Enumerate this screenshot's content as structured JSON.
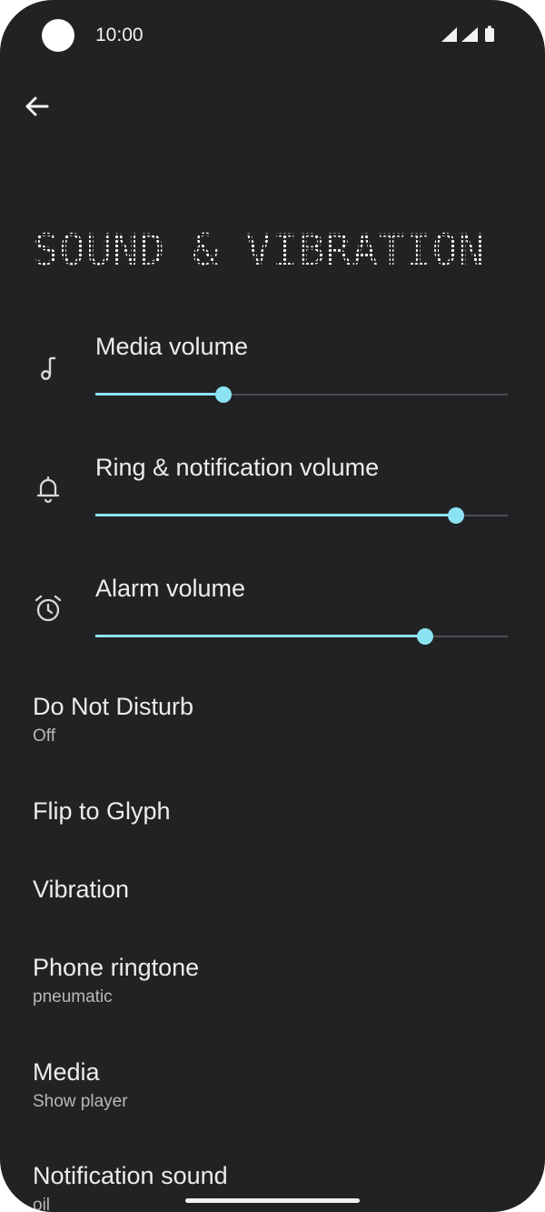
{
  "status_bar": {
    "time": "10:00",
    "icons": [
      "signal-icon",
      "signal-icon",
      "battery-icon"
    ]
  },
  "header": {
    "back_icon": "arrow-left-icon",
    "title": "SOUND & VIBRATION"
  },
  "volumes": [
    {
      "label": "Media volume",
      "icon": "music-note-icon",
      "level": 0.31
    },
    {
      "label": "Ring & notification volume",
      "icon": "bell-icon",
      "level": 0.875
    },
    {
      "label": "Alarm volume",
      "icon": "alarm-clock-icon",
      "level": 0.8
    }
  ],
  "accent_color": "#8be3f2",
  "background_color": "#212224",
  "preferences": [
    {
      "title": "Do Not Disturb",
      "summary": "Off"
    },
    {
      "title": "Flip to Glyph",
      "summary": ""
    },
    {
      "title": "Vibration",
      "summary": ""
    },
    {
      "title": "Phone ringtone",
      "summary": "pneumatic"
    },
    {
      "title": "Media",
      "summary": "Show player"
    },
    {
      "title": "Notification sound",
      "summary": "oil"
    }
  ]
}
